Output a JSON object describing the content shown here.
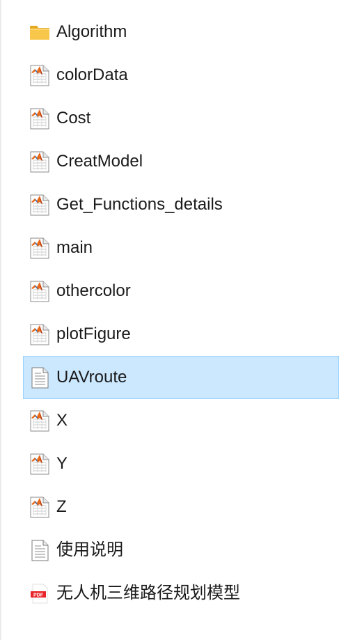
{
  "files": [
    {
      "name": "Algorithm",
      "icon": "folder-icon"
    },
    {
      "name": "colorData",
      "icon": "matlab-file-icon"
    },
    {
      "name": "Cost",
      "icon": "matlab-file-icon"
    },
    {
      "name": "CreatModel",
      "icon": "matlab-file-icon"
    },
    {
      "name": "Get_Functions_details",
      "icon": "matlab-file-icon"
    },
    {
      "name": "main",
      "icon": "matlab-file-icon"
    },
    {
      "name": "othercolor",
      "icon": "matlab-file-icon"
    },
    {
      "name": "plotFigure",
      "icon": "matlab-file-icon"
    },
    {
      "name": "UAVroute",
      "icon": "text-file-icon",
      "selected": true
    },
    {
      "name": "X",
      "icon": "matlab-file-icon"
    },
    {
      "name": "Y",
      "icon": "matlab-file-icon"
    },
    {
      "name": "Z",
      "icon": "matlab-file-icon"
    },
    {
      "name": "使用说明",
      "icon": "text-file-icon"
    },
    {
      "name": "无人机三维路径规划模型",
      "icon": "pdf-file-icon"
    }
  ],
  "colors": {
    "selection_background": "#cce8ff",
    "selection_border": "#99d1ff",
    "folder": "#f8c74a",
    "pdf_red": "#e8252b"
  }
}
